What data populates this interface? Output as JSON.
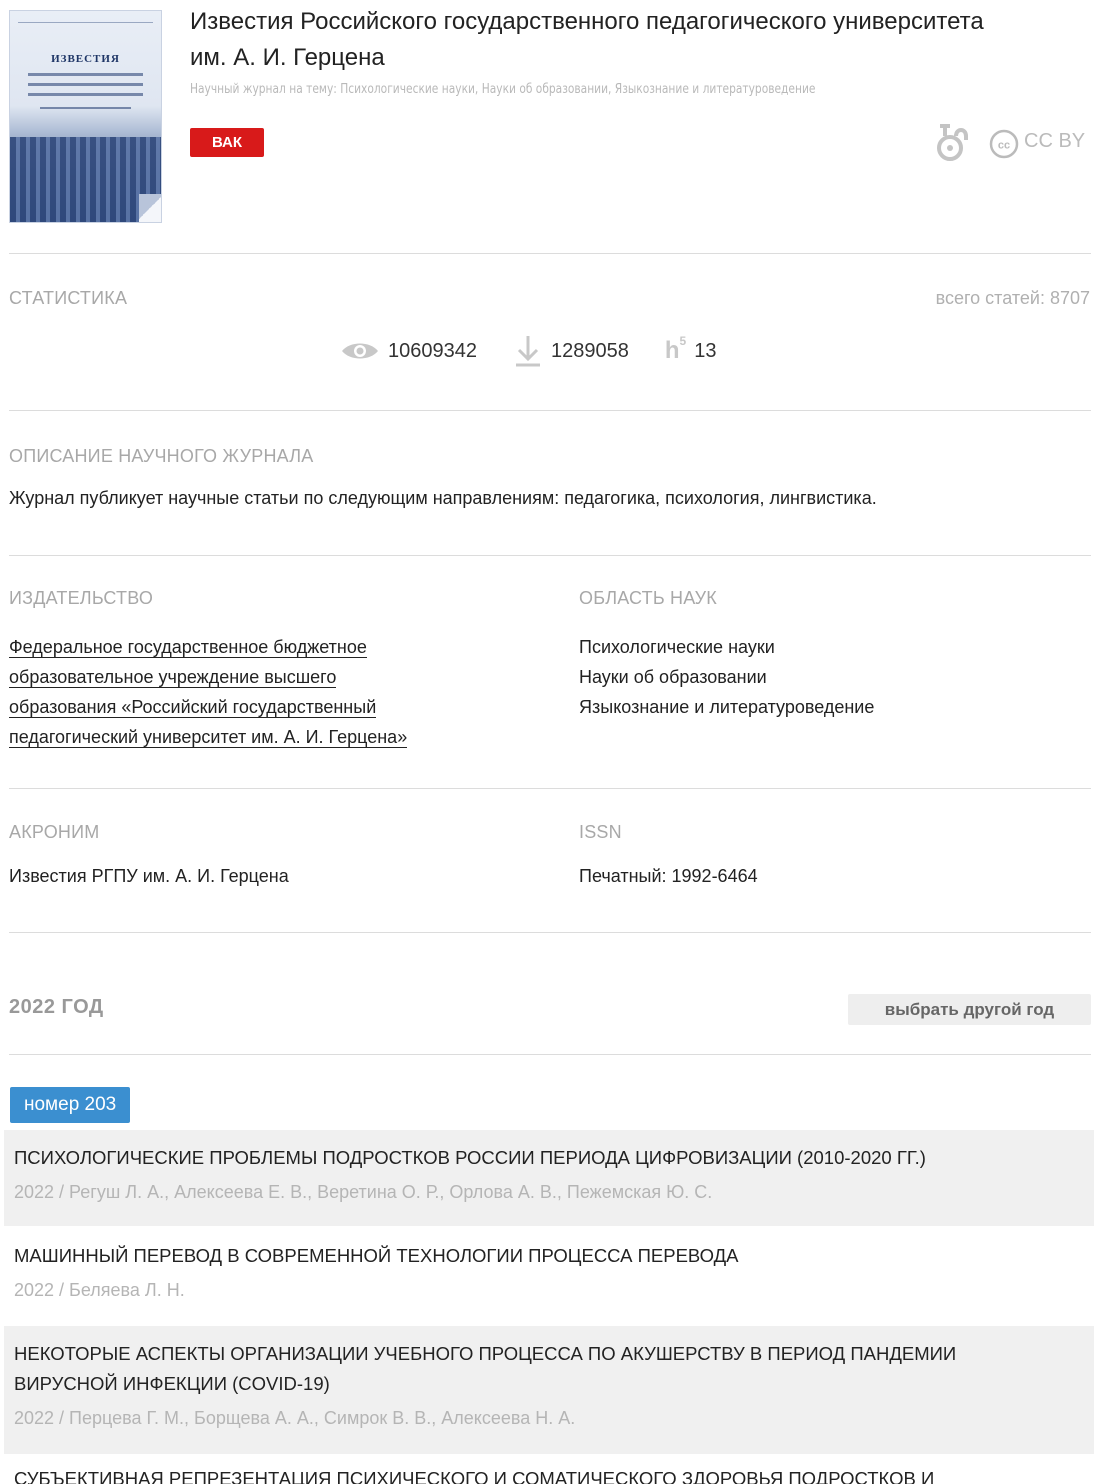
{
  "journal": {
    "title": "Известия Российского государственного педагогического университета им. А. И. Герцена",
    "subtitle": "Научный журнал на тему: Психологические науки, Науки об образовании, Языкознание и литературоведение",
    "badge": "ВАК",
    "license": "CC BY",
    "icons": [
      "open-access-icon",
      "cc-icon"
    ]
  },
  "cover_text": "ИЗВЕСТИЯ",
  "statistics": {
    "label": "СТАТИСТИКА",
    "total": "всего статей: 8707",
    "views": "10609342",
    "downloads": "1289058",
    "h_index": "13",
    "h_letter": "h",
    "h_sup": "5"
  },
  "description": {
    "label": "ОПИСАНИЕ НАУЧНОГО ЖУРНАЛА",
    "text": "Журнал публикует научные статьи по следующим направлениям: педагогика, психология, лингвистика."
  },
  "publisher": {
    "label": "ИЗДАТЕЛЬСТВО",
    "lines": [
      "Федеральное государственное бюджетное",
      "образовательное учреждение высшего",
      "образования «Российский государственный",
      "педагогический университет им. А. И. Герцена»"
    ]
  },
  "sciences": {
    "label": "ОБЛАСТЬ НАУК",
    "items": [
      "Психологические науки",
      "Науки об образовании",
      "Языкознание и литературоведение"
    ]
  },
  "acronym": {
    "label": "АКРОНИМ",
    "value": "Известия РГПУ им. А. И. Герцена"
  },
  "issn": {
    "label": "ISSN",
    "value": "Печатный: 1992-6464"
  },
  "year": {
    "label": "2022 ГОД",
    "button": "выбрать другой год"
  },
  "issue": {
    "label": "номер 203"
  },
  "articles": [
    {
      "title": "ПСИХОЛОГИЧЕСКИЕ ПРОБЛЕМЫ ПОДРОСТКОВ РОССИИ ПЕРИОДА ЦИФРОВИЗАЦИИ (2010-2020 ГГ.)",
      "meta": "2022 / Регуш Л. А., Алексеева Е. В., Веретина О. Р., Орлова А. В., Пежемская Ю. С."
    },
    {
      "title": "МАШИННЫЙ ПЕРЕВОД В СОВРЕМЕННОЙ ТЕХНОЛОГИИ ПРОЦЕССА ПЕРЕВОДА",
      "meta": "2022 / Беляева Л. Н."
    },
    {
      "title": "НЕКОТОРЫЕ АСПЕКТЫ ОРГАНИЗАЦИИ УЧЕБНОГО ПРОЦЕССА ПО АКУШЕРСТВУ В ПЕРИОД ПАНДЕМИИ ВИРУСНОЙ ИНФЕКЦИИ (COVID-19)",
      "meta": "2022 / Перцева Г. М., Борщева А. А., Симрок В. В., Алексеева Н. А."
    },
    {
      "title": "СУБЪЕКТИВНАЯ РЕПРЕЗЕНТАЦИЯ ПСИХИЧЕСКОГО И СОМАТИЧЕСКОГО ЗДОРОВЬЯ ПОДРОСТКОВ И",
      "meta": ""
    }
  ]
}
